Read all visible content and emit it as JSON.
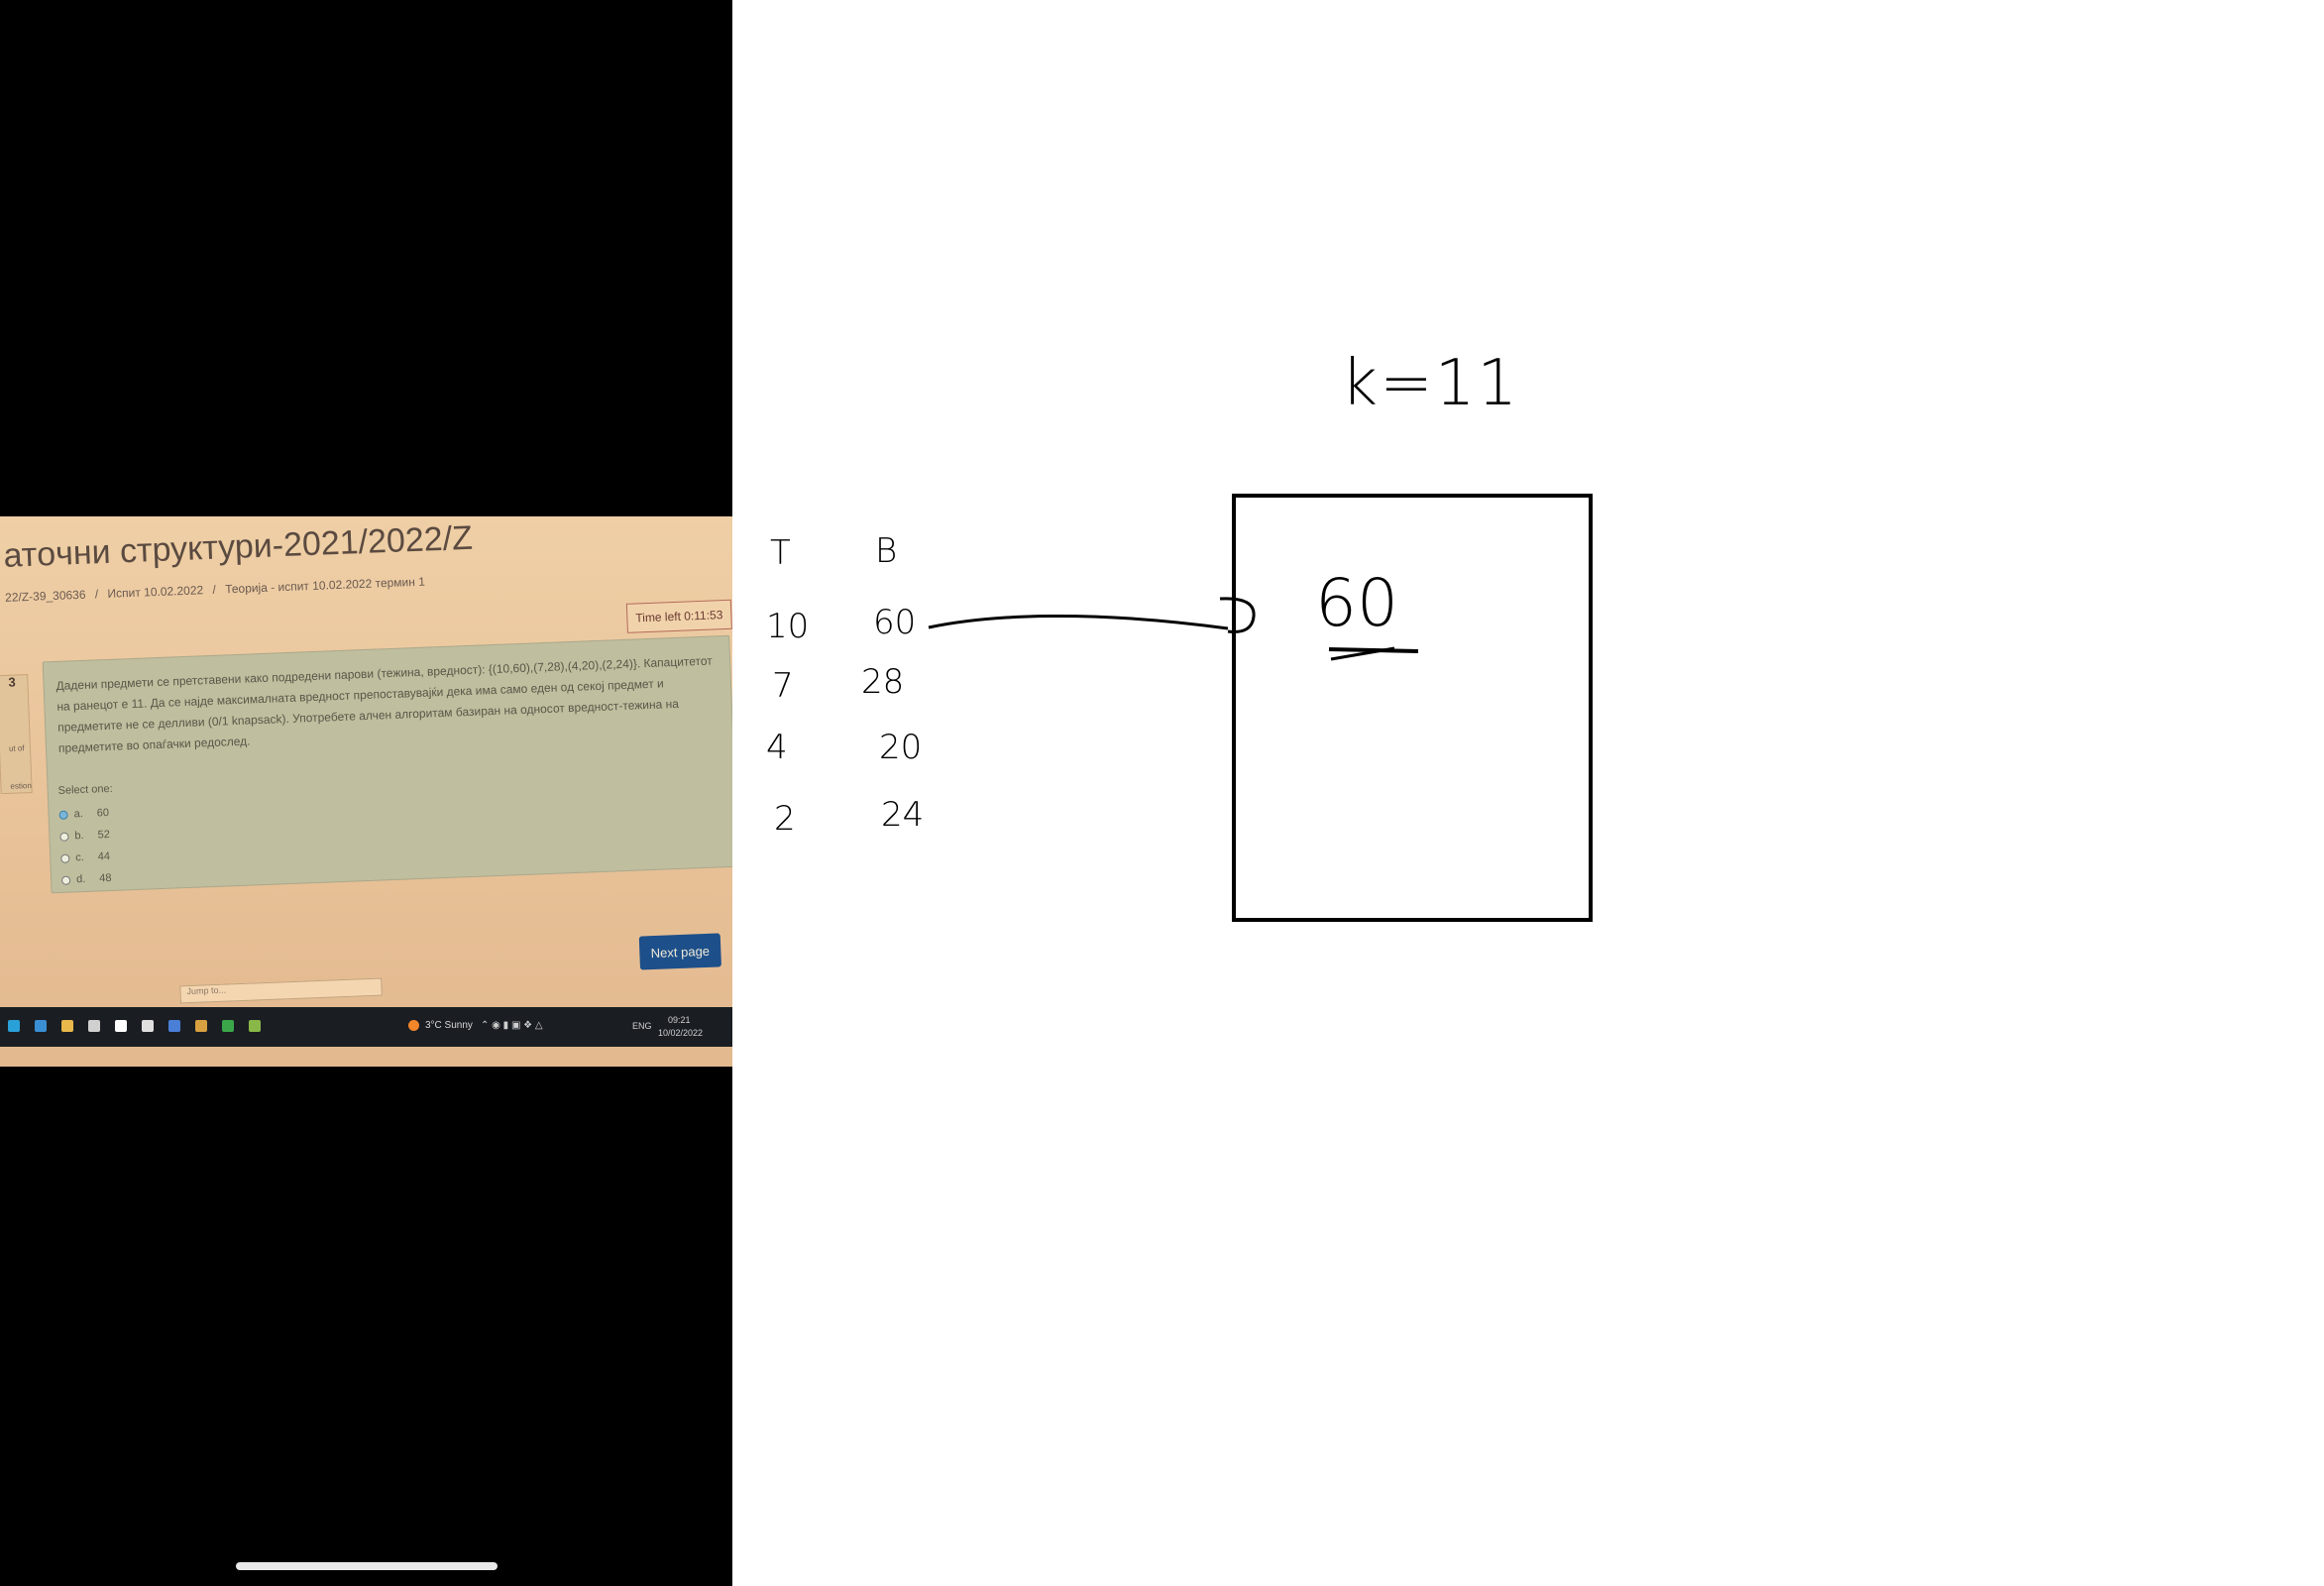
{
  "photo": {
    "course_title": "атoчни структури-2021/2022/Z",
    "breadcrumb": [
      "22/Z-39_30636",
      "/",
      "Испит 10.02.2022",
      "/",
      "Теорија - испит 10.02.2022 термин 1"
    ],
    "timer": "Time left 0:11:53",
    "question_number": "3",
    "question_side_1": "ut of",
    "question_side_2": "estion",
    "question_text": "Дадени предмети се претставени како подредени парови (тежина, вредност): {(10,60),(7,28),(4,20),(2,24)}. Капацитетот на ранецот е 11. Да се најде максималната вредност препоставувајќи дека има само еден од секој предмет и предметите не се делливи (0/1 knapsack). Употребете алчен алгоритам базиран на односот вредност-тежина на предметите во опаѓачки редослед.",
    "select_label": "Select one:",
    "options": [
      {
        "letter": "a.",
        "value": "60",
        "selected": true
      },
      {
        "letter": "b.",
        "value": "52",
        "selected": false
      },
      {
        "letter": "c.",
        "value": "44",
        "selected": false
      },
      {
        "letter": "d.",
        "value": "48",
        "selected": false
      }
    ],
    "next_button": "Next page",
    "jump_to": "Jump to...",
    "taskbar": {
      "weather": "3°C  Sunny",
      "language": "ENG",
      "time": "09:21",
      "date": "10/02/2022",
      "icons": [
        "edge-icon",
        "mail-icon",
        "folder-icon",
        "store-icon",
        "bolt-icon",
        "b-icon",
        "dropbox-icon",
        "chrome-icon",
        "chrome-icon-2",
        "app-icon"
      ],
      "icon_colors": [
        "#2aa0d8",
        "#3a8fd4",
        "#e8b84a",
        "#d0d0d0",
        "#ffffff",
        "#e0e0e0",
        "#4a7fd8",
        "#d8a040",
        "#3aa84a",
        "#8ab848"
      ]
    }
  },
  "whiteboard": {
    "capacity_label": "k=11",
    "table_headers": [
      "T",
      "B"
    ],
    "table_rows": [
      {
        "t": "10",
        "b": "60"
      },
      {
        "t": "7",
        "b": "28"
      },
      {
        "t": "4",
        "b": "20"
      },
      {
        "t": "2",
        "b": "24"
      }
    ],
    "box_value": "60"
  }
}
